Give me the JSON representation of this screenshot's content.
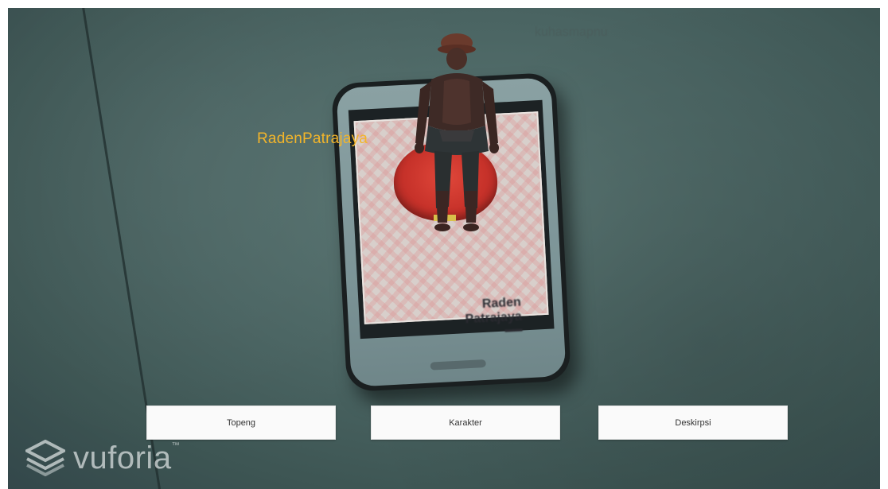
{
  "scene": {
    "ar_label": "RadenPatrajaya",
    "faint_label": "kuhasmapnu",
    "phone_screen_caption_line1": "Raden",
    "phone_screen_caption_line2": "Patrajaya"
  },
  "buttons": {
    "topeng_label": "Topeng",
    "karakter_label": "Karakter",
    "deskripsi_label": "Deskirpsi"
  },
  "watermark": {
    "brand": "vuforia",
    "tm": "™"
  },
  "colors": {
    "ar_label": "#f3b52a",
    "button_bg": "#fafafa",
    "mask_red": "#c7322a"
  }
}
